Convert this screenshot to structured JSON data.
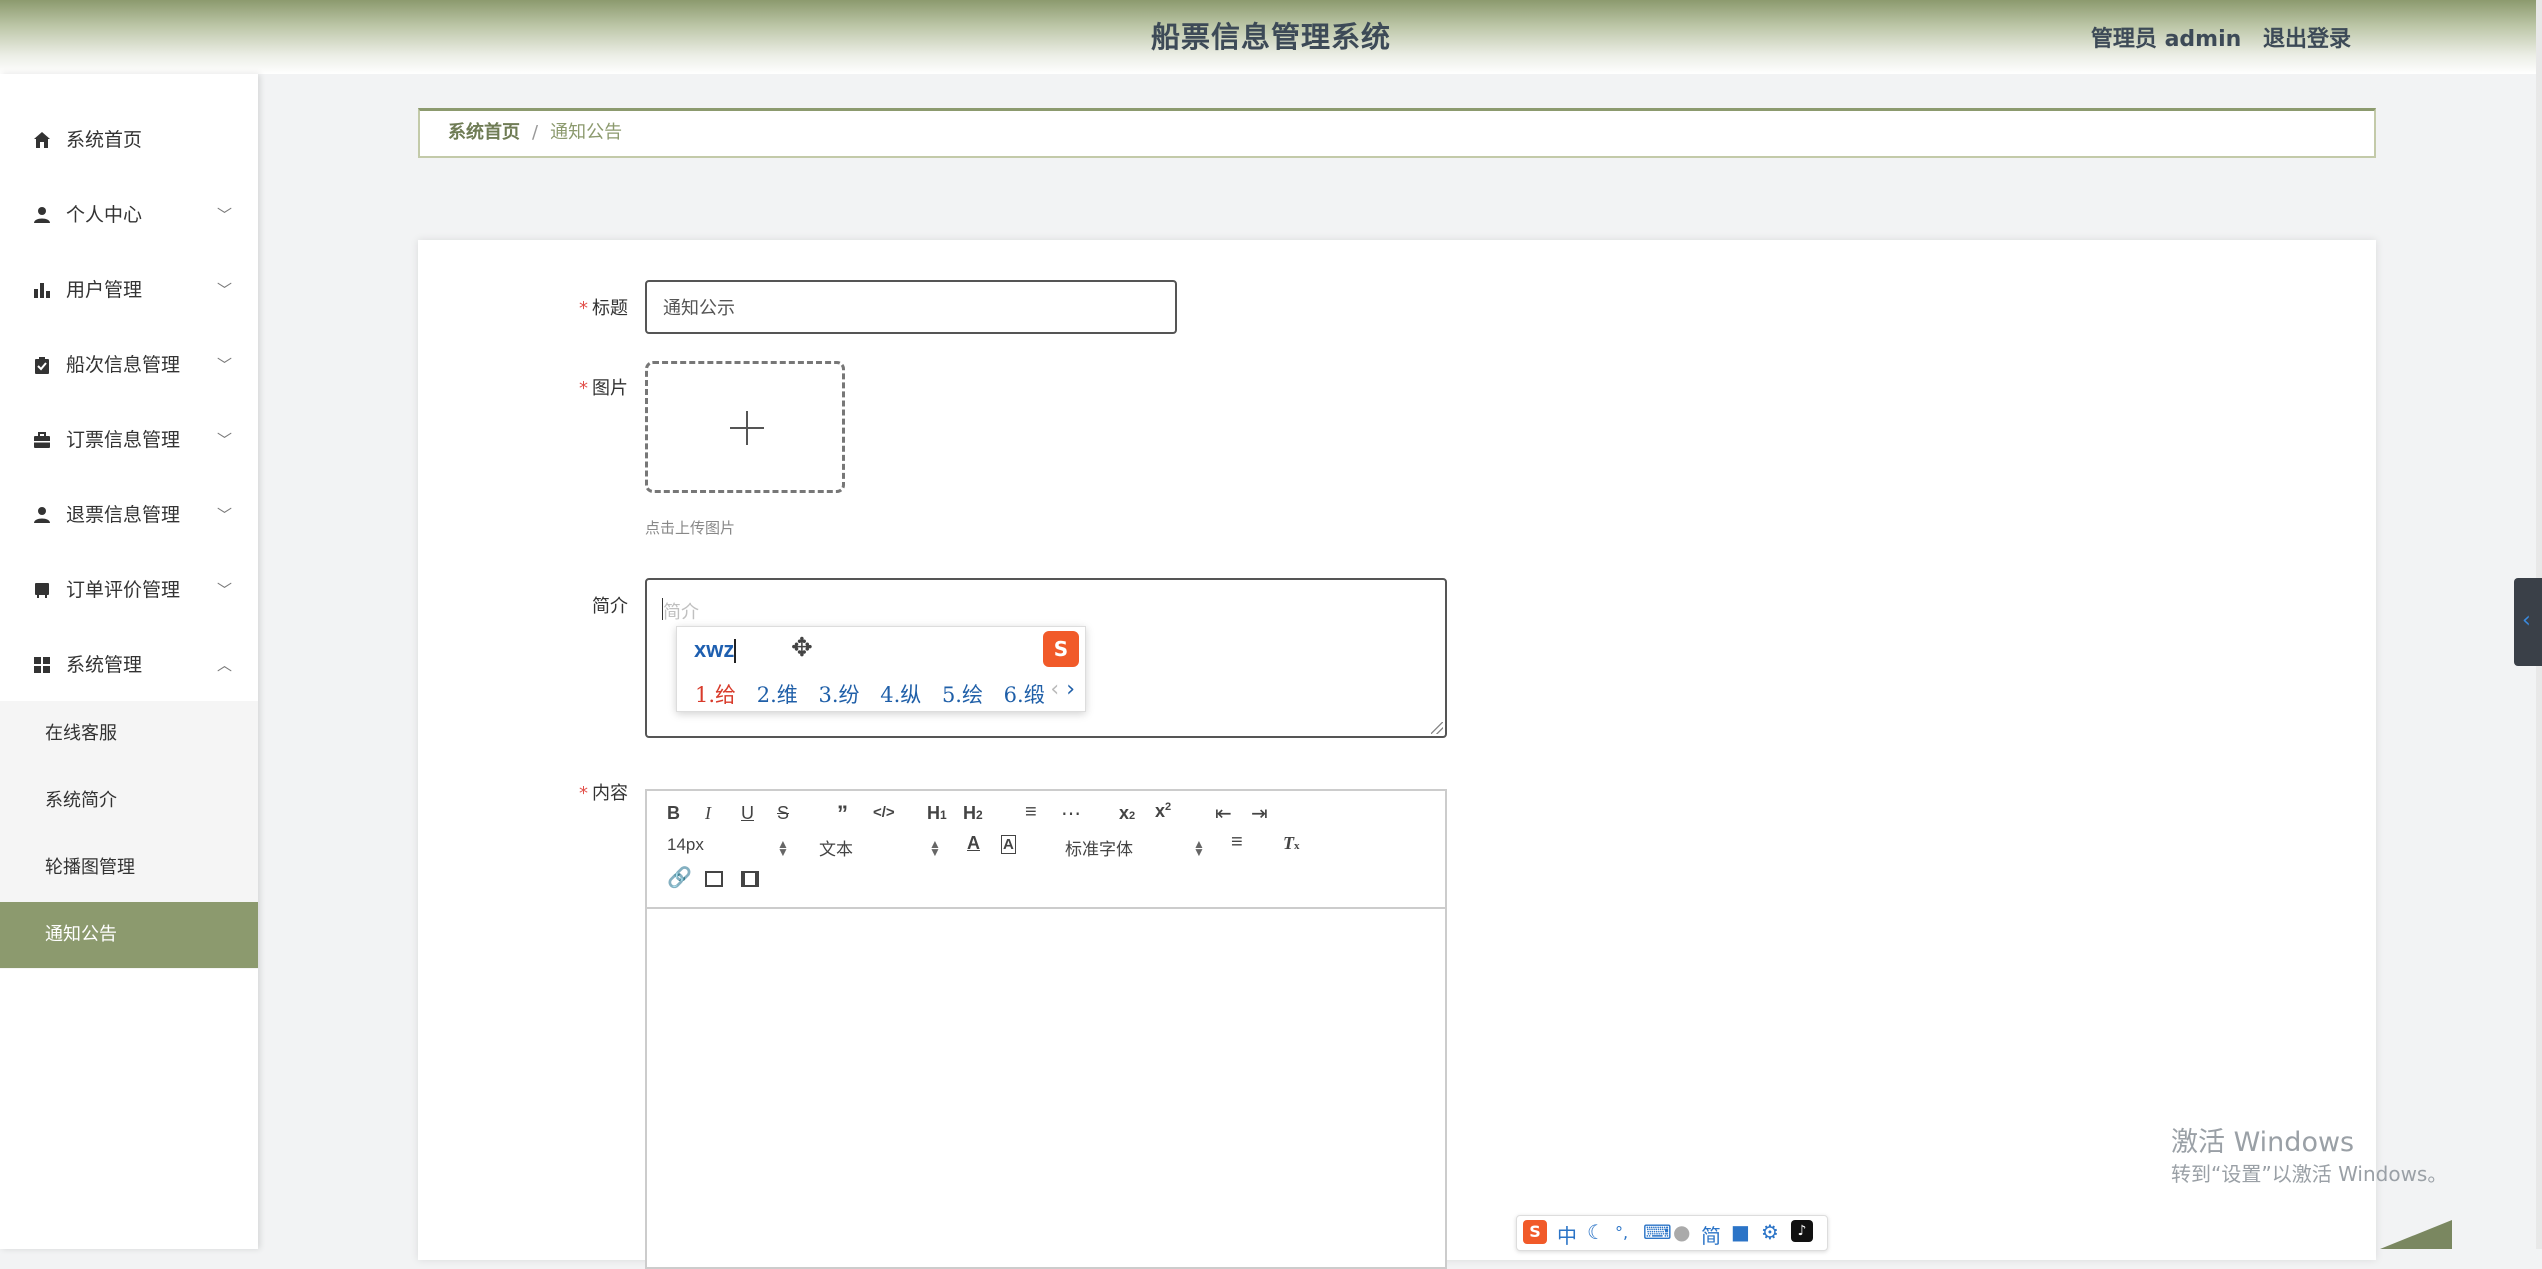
{
  "header": {
    "title": "船票信息管理系统",
    "user_role": "管理员 admin",
    "logout_label": "退出登录"
  },
  "sidebar": {
    "items": [
      {
        "label": "系统首页",
        "icon": "home-icon"
      },
      {
        "label": "个人中心",
        "icon": "user-icon"
      },
      {
        "label": "用户管理",
        "icon": "bar-chart-icon"
      },
      {
        "label": "船次信息管理",
        "icon": "clipboard-check-icon"
      },
      {
        "label": "订票信息管理",
        "icon": "briefcase-icon"
      },
      {
        "label": "退票信息管理",
        "icon": "user-icon"
      },
      {
        "label": "订单评价管理",
        "icon": "notebook-icon"
      },
      {
        "label": "系统管理",
        "icon": "grid-icon"
      }
    ],
    "submenu": [
      {
        "label": "在线客服"
      },
      {
        "label": "系统简介"
      },
      {
        "label": "轮播图管理"
      },
      {
        "label": "通知公告",
        "active": true
      }
    ]
  },
  "breadcrumb": {
    "home": "系统首页",
    "separator": "/",
    "current": "通知公告"
  },
  "form": {
    "title_label": "标题",
    "title_value": "通知公示",
    "image_label": "图片",
    "upload_tip": "点击上传图片",
    "intro_label": "简介",
    "intro_placeholder": "简介",
    "content_label": "内容"
  },
  "ime_popup": {
    "composition": "xwz",
    "candidates": [
      "1.给",
      "2.维",
      "3.纷",
      "4.纵",
      "5.绘",
      "6.缎"
    ]
  },
  "editor": {
    "font_size": "14px",
    "header_select": "文本",
    "font_family": "标准字体"
  },
  "watermark": {
    "title": "激活 Windows",
    "subtitle": "转到“设置”以激活 Windows。"
  },
  "ime_bar": {
    "mode": "中",
    "charset": "简"
  },
  "colors": {
    "accent": "#8c9a6e",
    "required": "#e2504a"
  }
}
